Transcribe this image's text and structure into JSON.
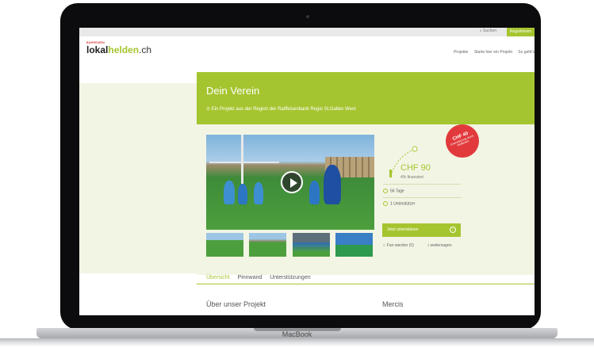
{
  "device": {
    "brand": "MacBook"
  },
  "topbar": {
    "search_label": "Suchen",
    "register_label": "Registrieren"
  },
  "logo": {
    "small_text": "RAIFFEISEN",
    "part1": "lokal",
    "part2": "helden",
    "part3": ".ch"
  },
  "nav": {
    "items": [
      {
        "label": "Projekte"
      },
      {
        "label": "Starte hier ein Projekt"
      },
      {
        "label": "So geht's"
      }
    ]
  },
  "hero": {
    "title": "Dein Verein",
    "subtitle": "Ein Projekt aus der Region der Raiffeisenbank Regio St.Gallen West"
  },
  "badge": {
    "amount": "CHF 40",
    "text": "Unterstützung durch Raiffeisen"
  },
  "funding": {
    "amount": "CHF 90",
    "percent_label": "4% finanziert",
    "progress": 0.04,
    "days": "56 Tage",
    "supporters": "1 Unterstützer"
  },
  "actions": {
    "support_label": "Jetzt unterstützen",
    "fan_label": "Fan werden (0)",
    "share_label": "weitersagen"
  },
  "tabs": [
    {
      "label": "Übersicht"
    },
    {
      "label": "Pinnwand"
    },
    {
      "label": "Unterstützungen"
    }
  ],
  "sections": {
    "about_title": "Über unser Projekt",
    "thanks_title": "Mercis"
  },
  "colors": {
    "accent": "#a5c530",
    "badge": "#e23a3c",
    "panel_bg": "#f2f5e4"
  }
}
